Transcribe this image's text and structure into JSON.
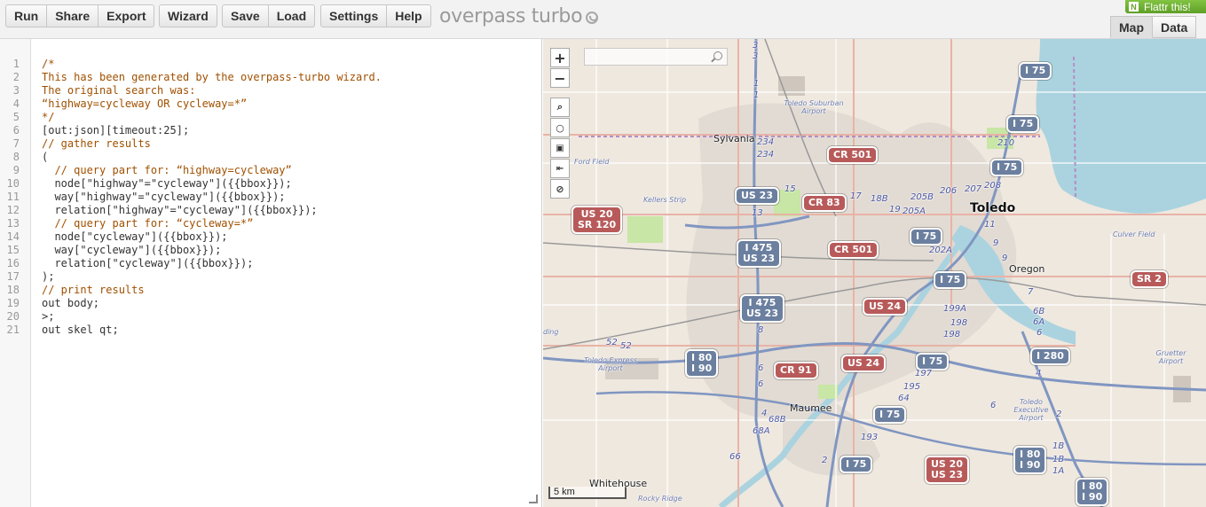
{
  "toolbar": {
    "groups": [
      [
        "Run",
        "Share",
        "Export"
      ],
      [
        "Wizard"
      ],
      [
        "Save",
        "Load"
      ],
      [
        "Settings",
        "Help"
      ]
    ],
    "logo_text": "overpass turbo",
    "flattr_label": "Flattr this!",
    "flattr_icon_letter": "N",
    "tabs": [
      "Map",
      "Data"
    ],
    "active_tab": "Map"
  },
  "editor": {
    "line_numbers": [
      "1",
      "2",
      "3",
      "4",
      "5",
      "6",
      "7",
      "8",
      "9",
      "10",
      "11",
      "12",
      "13",
      "14",
      "15",
      "16",
      "17",
      "18",
      "19",
      "20",
      "21"
    ],
    "lines": [
      "/*",
      "This has been generated by the overpass-turbo wizard.",
      "The original search was:",
      "“highway=cycleway OR cycleway=*”",
      "*/",
      "[out:json][timeout:25];",
      "// gather results",
      "(",
      "  // query part for: “highway=cycleway”",
      "  node[\"highway\"=\"cycleway\"]({{bbox}});",
      "  way[\"highway\"=\"cycleway\"]({{bbox}});",
      "  relation[\"highway\"=\"cycleway\"]({{bbox}});",
      "  // query part for: “cycleway=*”",
      "  node[\"cycleway\"]({{bbox}});",
      "  way[\"cycleway\"]({{bbox}});",
      "  relation[\"cycleway\"]({{bbox}});",
      ");",
      "// print results",
      "out body;",
      ">;",
      "out skel qt;"
    ],
    "comment_lines": [
      0,
      1,
      2,
      3,
      4,
      6,
      8,
      12,
      17
    ]
  },
  "map": {
    "controls": {
      "zoom_in": "+",
      "zoom_out": "−"
    },
    "scale_label": "5 km",
    "places": {
      "toledo": "Toledo",
      "oregon": "Oregon",
      "sylvania": "Sylvania",
      "maumee": "Maumee",
      "whitehouse": "Whitehouse",
      "toledo_suburban_airport": "Toledo Suburban Airport",
      "ford_field": "Ford Field",
      "kellers_strip": "Kellers Strip",
      "culver_field": "Culver Field",
      "toledo_express_airport": "Toledo Express Airport",
      "gruetter_airport": "Gruetter Airport",
      "toledo_executive_airport": "Toledo Executive Airport",
      "rocky_ridge": "Rocky Ridge",
      "landing": "ding"
    },
    "shields": {
      "i75_a": "I 75",
      "i75_b": "I 75",
      "i75_c": "I 75",
      "i75_d": "I 75",
      "i75_e": "I 75",
      "i75_f": "I 75",
      "i75_g": "I 75",
      "cr501_a": "CR 501",
      "cr501_b": "CR 501",
      "us23": "US 23",
      "cr83": "CR 83",
      "us20_sr120": "US 20\nSR 120",
      "i475_us23_a": "I 475\nUS 23",
      "i475_us23_b": "I 475\nUS 23",
      "us24_a": "US 24",
      "us24_b": "US 24",
      "sr2": "SR 2",
      "i80_i90_a": "I 80\nI 90",
      "i80_i90_b": "I 80\nI 90",
      "i80_i90_c": "I 80\nI 90",
      "cr91": "CR 91",
      "i280": "I 280",
      "us20_us23": "US 20\nUS 23"
    },
    "exits": {
      "e3a": "3",
      "e3b": "3",
      "e1a": "1",
      "e1b": "1",
      "e234a": "234",
      "e234b": "234",
      "e15": "15",
      "e13": "13",
      "e17": "17",
      "e18b": "18B",
      "e19": "19",
      "e205b": "205B",
      "e205a": "205A",
      "e206": "206",
      "e207": "207",
      "e208": "208",
      "e210": "210",
      "e11": "11",
      "e9a": "9",
      "e9b": "9",
      "e202a": "202A",
      "e7": "7",
      "e6b": "6B",
      "e6a": "6A",
      "e6": "6",
      "e199a": "199A",
      "e198a": "198",
      "e198b": "198",
      "e8": "8",
      "e52a": "52",
      "e52b": "52",
      "e6c": "6",
      "e6d": "6",
      "e197": "197",
      "e195": "195",
      "e64": "64",
      "e4a": "4",
      "e4b": "4",
      "e68b": "68B",
      "e68a": "68A",
      "e193": "193",
      "e2a": "2",
      "e66": "66",
      "e6e": "6",
      "e2b": "2",
      "e1b2": "1B",
      "e1b3": "1B",
      "e1a2": "1A"
    }
  }
}
